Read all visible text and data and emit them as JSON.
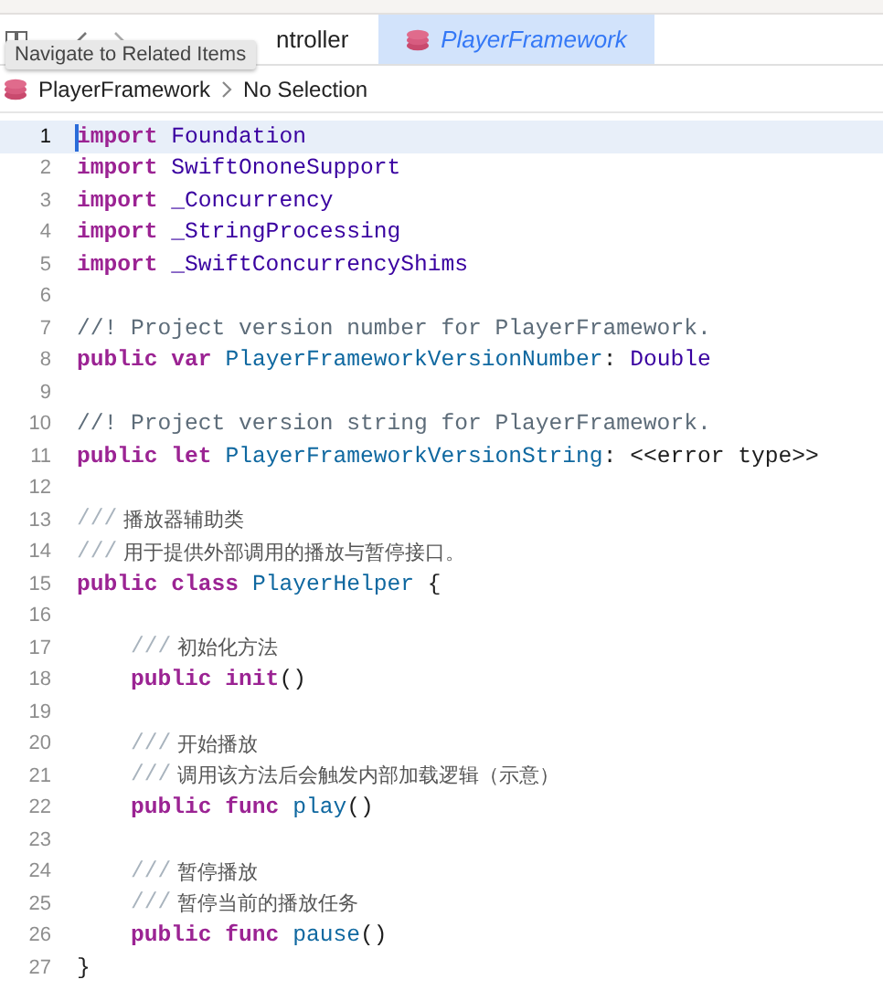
{
  "tooltip": {
    "text": "Navigate to Related Items"
  },
  "tabs": [
    {
      "label": "ntroller",
      "selected": false
    },
    {
      "label": "PlayerFramework",
      "selected": true
    }
  ],
  "breadcrumb": [
    "PlayerFramework",
    "No Selection"
  ],
  "code_lines": [
    {
      "number": "1",
      "highlighted": true,
      "tokens": [
        {
          "kind": "keyword",
          "text": "import "
        },
        {
          "kind": "type",
          "text": "Foundation"
        }
      ]
    },
    {
      "number": "2",
      "highlighted": false,
      "tokens": [
        {
          "kind": "keyword",
          "text": "import "
        },
        {
          "kind": "type",
          "text": "SwiftOnoneSupport"
        }
      ]
    },
    {
      "number": "3",
      "highlighted": false,
      "tokens": [
        {
          "kind": "keyword",
          "text": "import "
        },
        {
          "kind": "type",
          "text": "_Concurrency"
        }
      ]
    },
    {
      "number": "4",
      "highlighted": false,
      "tokens": [
        {
          "kind": "keyword",
          "text": "import "
        },
        {
          "kind": "type",
          "text": "_StringProcessing"
        }
      ]
    },
    {
      "number": "5",
      "highlighted": false,
      "tokens": [
        {
          "kind": "keyword",
          "text": "import "
        },
        {
          "kind": "type",
          "text": "_SwiftConcurrencyShims"
        }
      ]
    },
    {
      "number": "6",
      "highlighted": false
    },
    {
      "number": "7",
      "highlighted": false,
      "tokens": [
        {
          "kind": "comment",
          "text": "//! Project version number for PlayerFramework."
        }
      ]
    },
    {
      "number": "8",
      "highlighted": false,
      "tokens": [
        {
          "kind": "keyword",
          "text": "public var "
        },
        {
          "kind": "declaration",
          "text": "PlayerFrameworkVersionNumber"
        },
        {
          "kind": "plain",
          "text": ": "
        },
        {
          "kind": "type",
          "text": "Double"
        }
      ]
    },
    {
      "number": "9",
      "highlighted": false
    },
    {
      "number": "10",
      "highlighted": false,
      "tokens": [
        {
          "kind": "comment",
          "text": "//! Project version string for PlayerFramework."
        }
      ]
    },
    {
      "number": "11",
      "highlighted": false,
      "tokens": [
        {
          "kind": "keyword",
          "text": "public let "
        },
        {
          "kind": "declaration",
          "text": "PlayerFrameworkVersionString"
        },
        {
          "kind": "plain",
          "text": ": <<error type>>"
        }
      ]
    },
    {
      "number": "12",
      "highlighted": false
    },
    {
      "number": "13",
      "highlighted": false,
      "tokens": [
        {
          "kind": "doc-marker",
          "text": "///"
        },
        {
          "kind": "doc",
          "text": " 播放器辅助类"
        }
      ]
    },
    {
      "number": "14",
      "highlighted": false,
      "tokens": [
        {
          "kind": "doc-marker",
          "text": "///"
        },
        {
          "kind": "doc",
          "text": " 用于提供外部调用的播放与暂停接口。"
        }
      ]
    },
    {
      "number": "15",
      "highlighted": false,
      "tokens": [
        {
          "kind": "keyword",
          "text": "public class "
        },
        {
          "kind": "declaration",
          "text": "PlayerHelper"
        },
        {
          "kind": "plain",
          "text": " {"
        }
      ]
    },
    {
      "number": "16",
      "highlighted": false
    },
    {
      "number": "17",
      "highlighted": false,
      "tokens": [
        {
          "kind": "doc-marker",
          "text": "    ///"
        },
        {
          "kind": "doc",
          "text": " 初始化方法"
        }
      ]
    },
    {
      "number": "18",
      "highlighted": false,
      "tokens": [
        {
          "kind": "keyword",
          "text": "    public init"
        },
        {
          "kind": "plain",
          "text": "()"
        }
      ]
    },
    {
      "number": "19",
      "highlighted": false
    },
    {
      "number": "20",
      "highlighted": false,
      "tokens": [
        {
          "kind": "doc-marker",
          "text": "    ///"
        },
        {
          "kind": "doc",
          "text": " 开始播放"
        }
      ]
    },
    {
      "number": "21",
      "highlighted": false,
      "tokens": [
        {
          "kind": "doc-marker",
          "text": "    ///"
        },
        {
          "kind": "doc",
          "text": " 调用该方法后会触发内部加载逻辑（示意）"
        }
      ]
    },
    {
      "number": "22",
      "highlighted": false,
      "tokens": [
        {
          "kind": "keyword",
          "text": "    public func "
        },
        {
          "kind": "declaration",
          "text": "play"
        },
        {
          "kind": "plain",
          "text": "()"
        }
      ]
    },
    {
      "number": "23",
      "highlighted": false
    },
    {
      "number": "24",
      "highlighted": false,
      "tokens": [
        {
          "kind": "doc-marker",
          "text": "    ///"
        },
        {
          "kind": "doc",
          "text": " 暂停播放"
        }
      ]
    },
    {
      "number": "25",
      "highlighted": false,
      "tokens": [
        {
          "kind": "doc-marker",
          "text": "    ///"
        },
        {
          "kind": "doc",
          "text": " 暂停当前的播放任务"
        }
      ]
    },
    {
      "number": "26",
      "highlighted": false,
      "tokens": [
        {
          "kind": "keyword",
          "text": "    public func "
        },
        {
          "kind": "declaration",
          "text": "pause"
        },
        {
          "kind": "plain",
          "text": "()"
        }
      ]
    },
    {
      "number": "27",
      "highlighted": false,
      "tokens": [
        {
          "kind": "plain",
          "text": "}"
        }
      ]
    }
  ]
}
